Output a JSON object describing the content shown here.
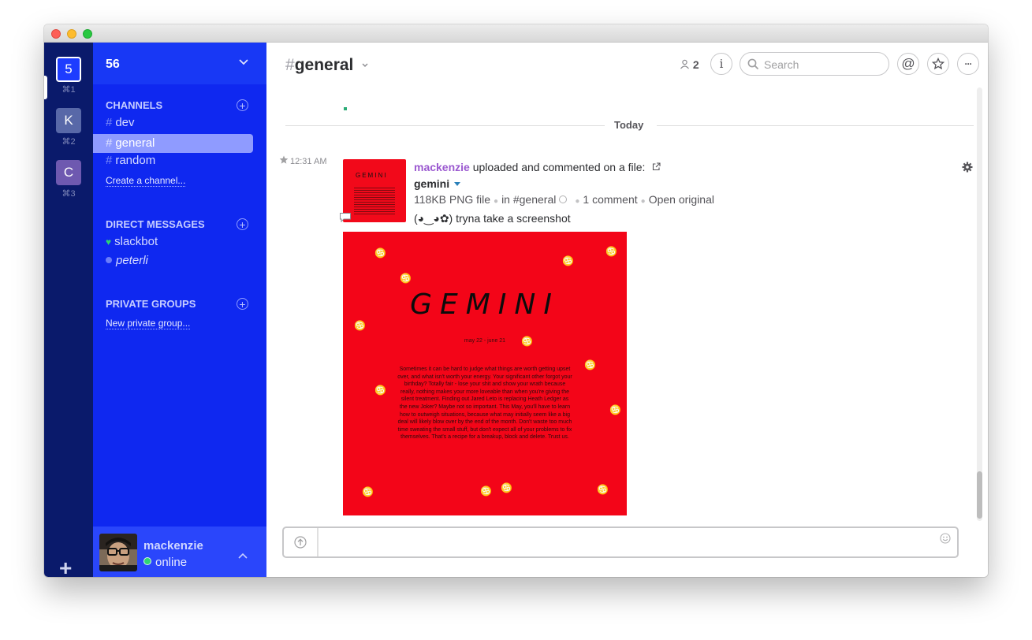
{
  "teams": [
    {
      "letter": "5",
      "shortcut": "⌘1",
      "color": "#1e3cff",
      "active": true
    },
    {
      "letter": "K",
      "shortcut": "⌘2",
      "color": "#5868a8"
    },
    {
      "letter": "C",
      "shortcut": "⌘3",
      "color": "#6e59b0"
    }
  ],
  "add_team_label": "+",
  "sidebar": {
    "team_name": "56",
    "channels_title": "CHANNELS",
    "channels": [
      "dev",
      "general",
      "random"
    ],
    "create_channel": "Create a channel...",
    "dm_title": "DIRECT MESSAGES",
    "dms": [
      "slackbot",
      "peterli"
    ],
    "groups_title": "PRIVATE GROUPS",
    "new_group": "New private group..."
  },
  "user": {
    "name": "mackenzie",
    "status": "online"
  },
  "header": {
    "channel": "general",
    "hash": "#",
    "member_count": "2",
    "search_placeholder": "Search",
    "at_label": "@",
    "info_label": "i",
    "more_label": "···"
  },
  "messages": {
    "divider": "Today",
    "time": "12:31 AM",
    "author": "mackenzie",
    "action": "uploaded and commented on a file:",
    "file_name": "gemini",
    "file_size": "118KB PNG file",
    "file_channel": "in #general",
    "comments": "1 comment",
    "open_original": "Open original",
    "comment_text": "(◕‿◕✿) tryna take a screenshot"
  },
  "image": {
    "title": "GEMINI",
    "thumb_title": "GEMINI",
    "date": "may 22 - june 21",
    "body": "Sometimes it can be hard to judge what things are worth getting upset over, and what isn't worth your energy. Your significant other forgot your birthday? Totally fair - lose your shit and show your wrath because really, nothing makes your more loveable than when you're giving the silent treatment. Finding out Jared Leto is replacing Heath Ledger as the new Joker? Maybe not so important. This May, you'll have to learn how to outweigh situations, because what may initially seem like a big deal will likely blow over by the end of the month. Don't waste too much time sweating the small stuff, but don't expect all of your problems to fix themselves. That's a recipe for a breakup, block and delete. Trust us.",
    "glyph": "♋"
  },
  "colors": {
    "team_rail": "#0a1a6b",
    "sidebar": "#0f28f0",
    "active_channel": "#8f9bff",
    "author": "#9b59d0",
    "image_red": "#f30518"
  }
}
